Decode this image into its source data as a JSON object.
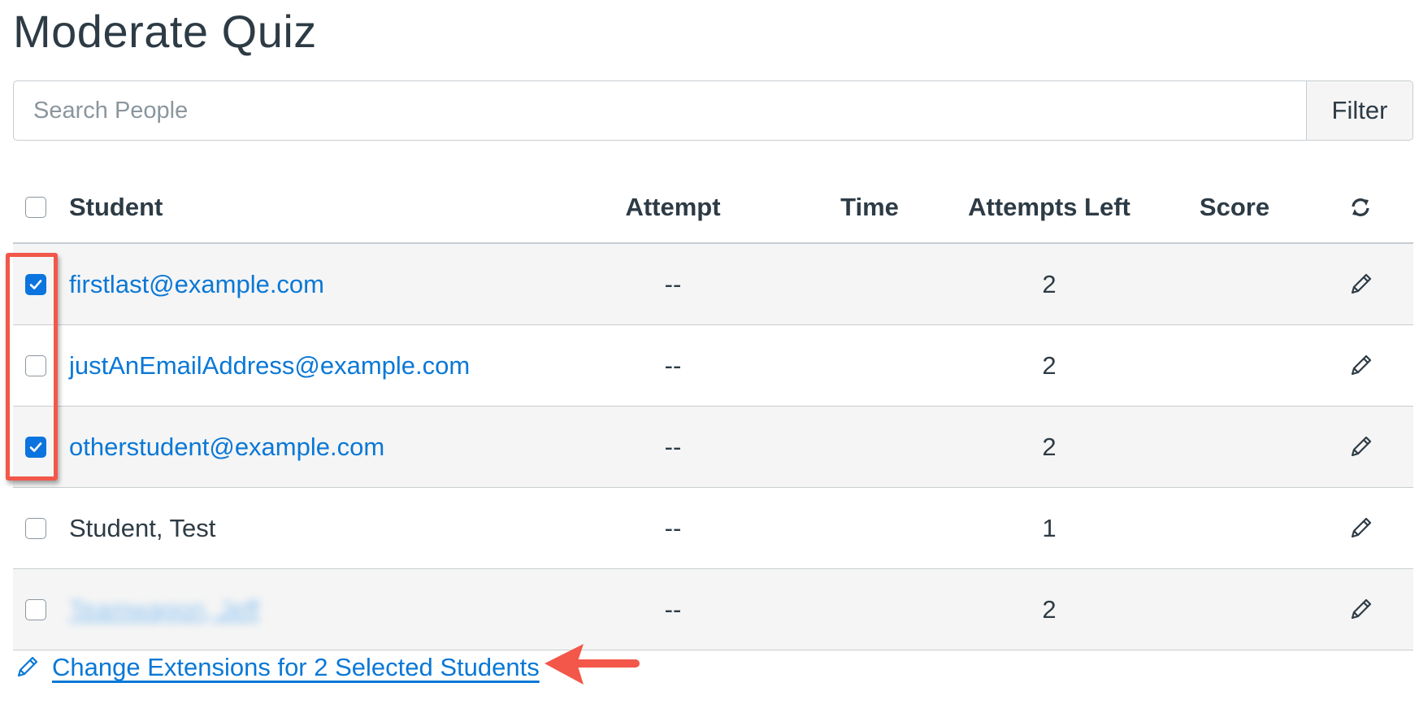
{
  "page": {
    "title": "Moderate Quiz"
  },
  "search": {
    "placeholder": "Search People",
    "value": "",
    "filter_label": "Filter"
  },
  "table": {
    "headers": {
      "student": "Student",
      "attempt": "Attempt",
      "time": "Time",
      "attempts_left": "Attempts Left",
      "score": "Score",
      "refresh_icon": "refresh-icon"
    },
    "rows": [
      {
        "student": "firstlast@example.com",
        "attempt": "--",
        "time": "",
        "attempts_left": "2",
        "score": "",
        "checked": true,
        "is_link": true,
        "blurred": false
      },
      {
        "student": "justAnEmailAddress@example.com",
        "attempt": "--",
        "time": "",
        "attempts_left": "2",
        "score": "",
        "checked": false,
        "is_link": true,
        "blurred": false
      },
      {
        "student": "otherstudent@example.com",
        "attempt": "--",
        "time": "",
        "attempts_left": "2",
        "score": "",
        "checked": true,
        "is_link": true,
        "blurred": false
      },
      {
        "student": "Student, Test",
        "attempt": "--",
        "time": "",
        "attempts_left": "1",
        "score": "",
        "checked": false,
        "is_link": false,
        "blurred": false
      },
      {
        "student": "Teamwagon, Jeff",
        "attempt": "--",
        "time": "",
        "attempts_left": "2",
        "score": "",
        "checked": false,
        "is_link": true,
        "blurred": true
      }
    ]
  },
  "bulk_action": {
    "label": "Change Extensions for 2 Selected Students",
    "icon": "pencil-icon"
  },
  "colors": {
    "link": "#0a78d6",
    "checked": "#0b74de",
    "annotation": "#f2574a",
    "row_alt": "#f5f5f5"
  }
}
